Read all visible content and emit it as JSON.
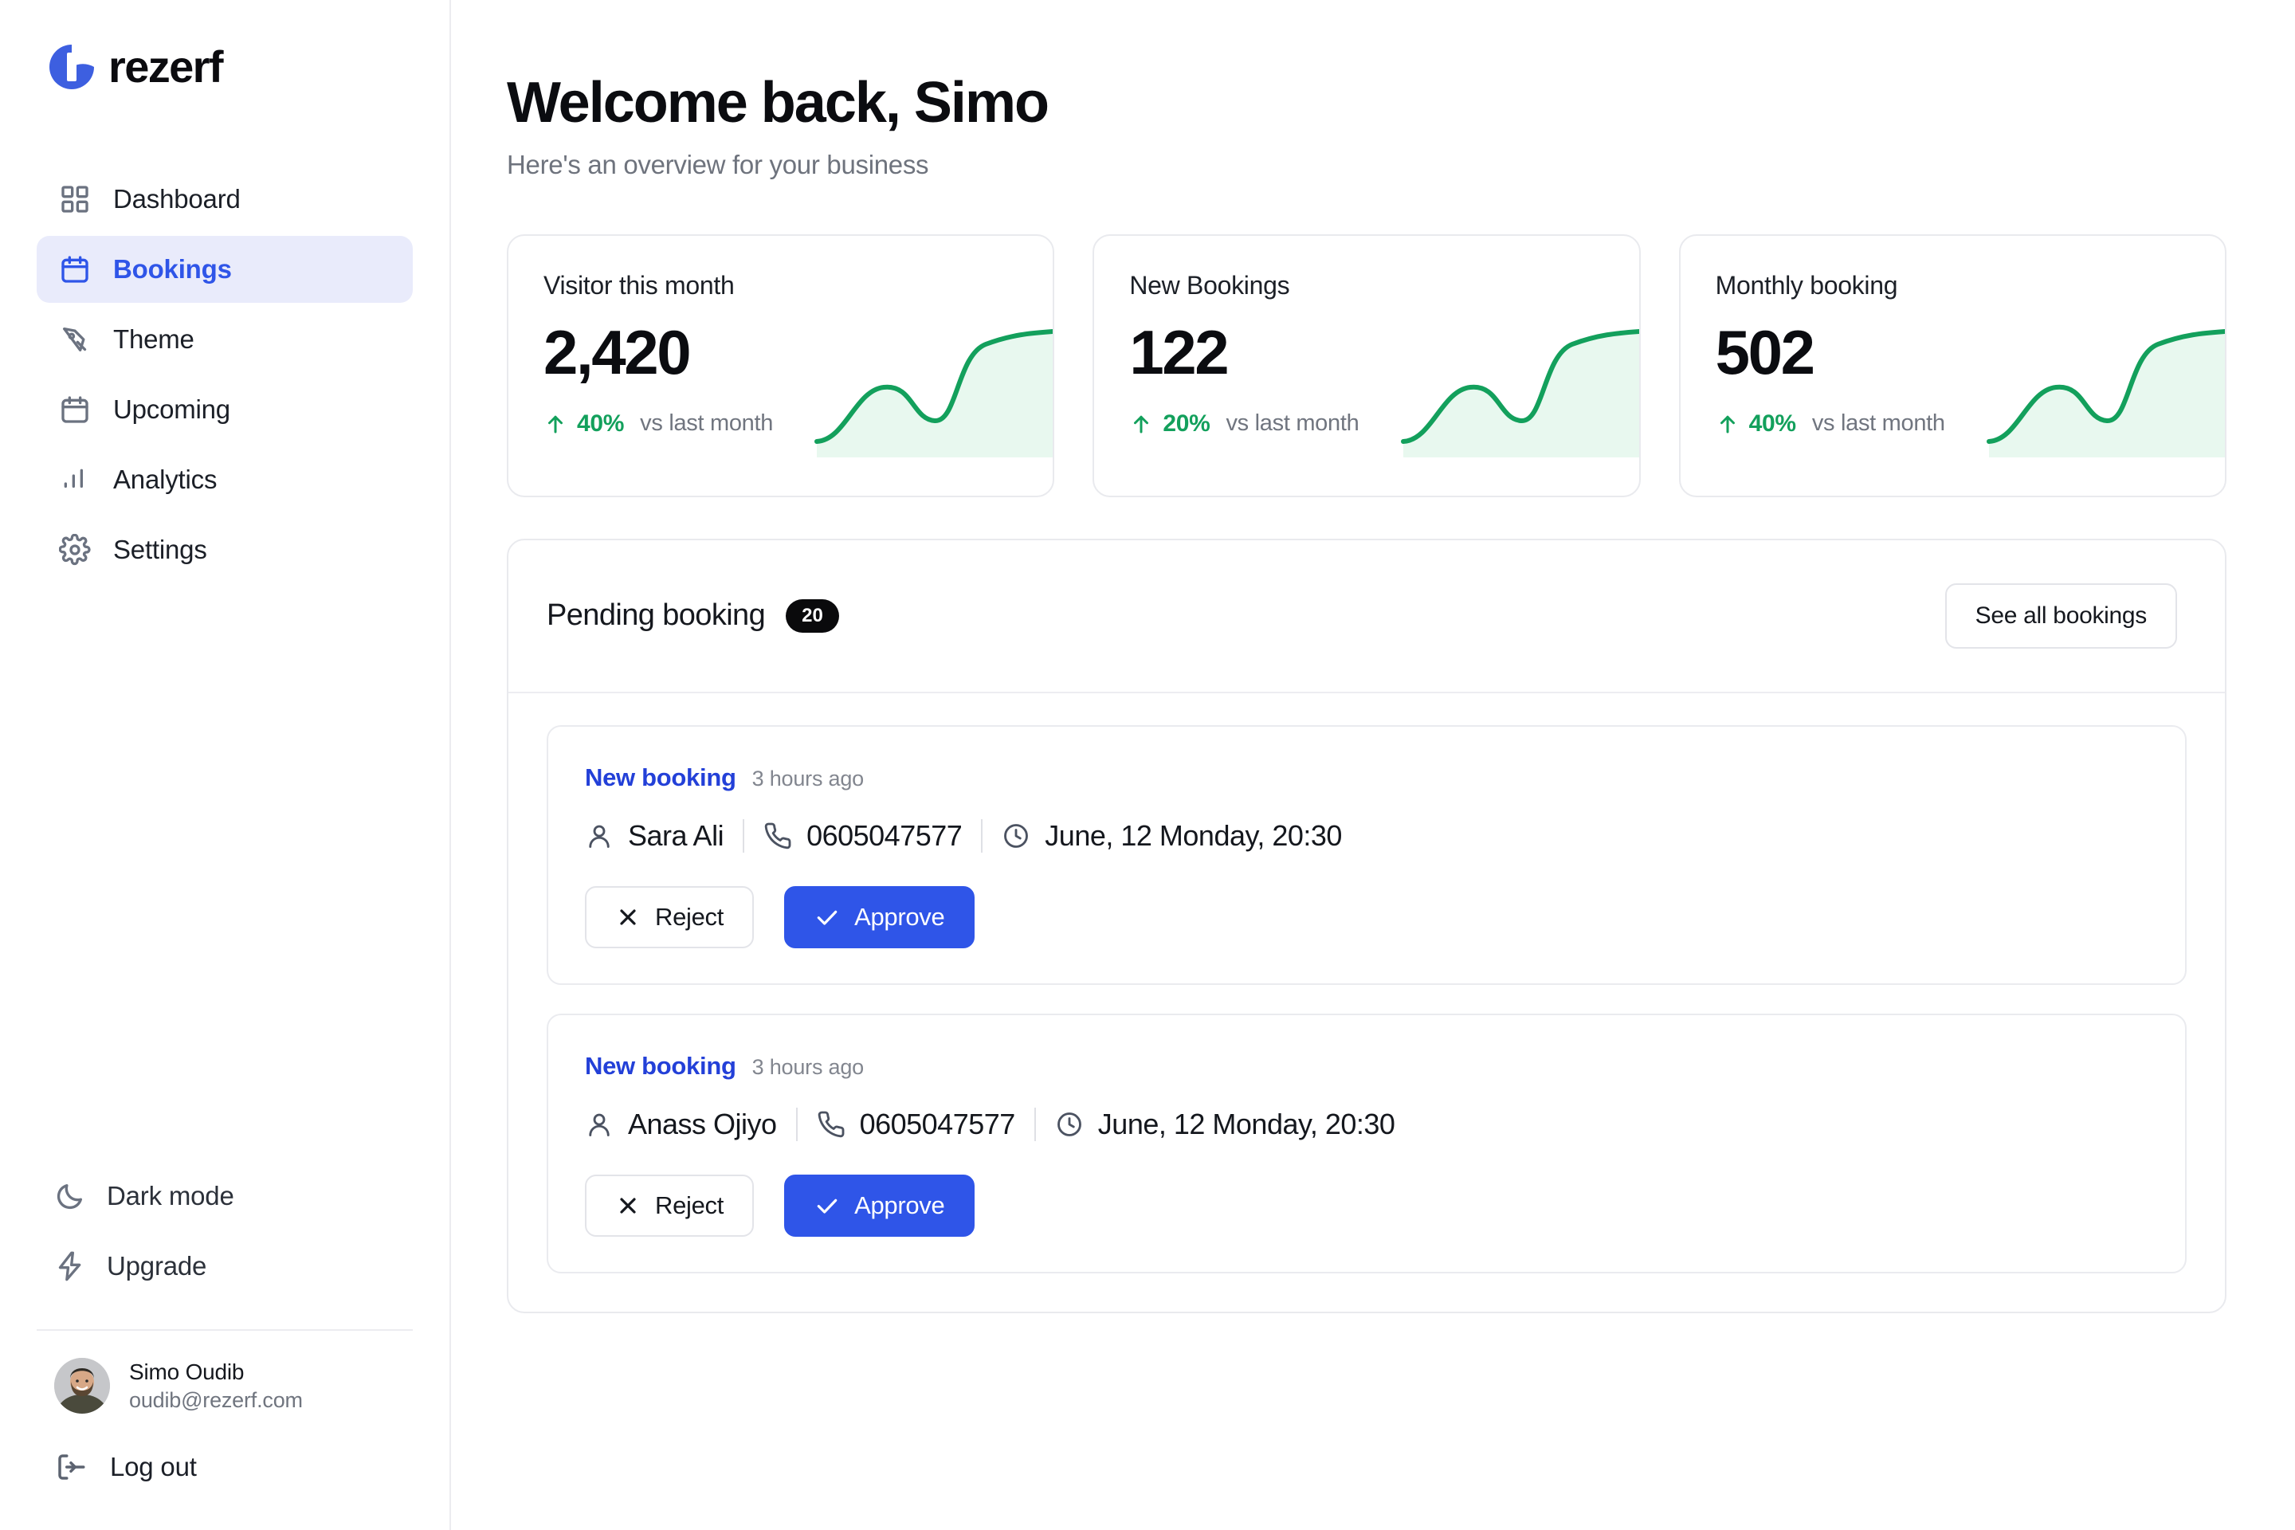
{
  "brand": {
    "name": "rezerf",
    "logo_icon": "rezerf-logo-mark",
    "color": "#3d5fe0"
  },
  "sidebar": {
    "nav": [
      {
        "label": "Dashboard",
        "icon": "grid-icon",
        "active": false
      },
      {
        "label": "Bookings",
        "icon": "calendar-icon",
        "active": true
      },
      {
        "label": "Theme",
        "icon": "pen-nib-icon",
        "active": false
      },
      {
        "label": "Upcoming",
        "icon": "calendar-icon",
        "active": false
      },
      {
        "label": "Analytics",
        "icon": "bar-chart-icon",
        "active": false
      },
      {
        "label": "Settings",
        "icon": "gear-icon",
        "active": false
      }
    ],
    "utility": [
      {
        "label": "Dark mode",
        "icon": "moon-icon"
      },
      {
        "label": "Upgrade",
        "icon": "lightning-bolt-icon"
      }
    ],
    "profile": {
      "name": "Simo Oudib",
      "email": "oudib@rezerf.com",
      "avatar_icon": "user-avatar-photo"
    },
    "logout": {
      "label": "Log out",
      "icon": "logout-icon"
    }
  },
  "header": {
    "title": "Welcome back, Simo",
    "subtitle": "Here's an overview for your business"
  },
  "stats": [
    {
      "title": "Visitor this month",
      "value": "2,420",
      "delta": "40%",
      "delta_note": "vs last month",
      "trend_icon": "arrow-up-icon",
      "accent": "#13a05c"
    },
    {
      "title": "New Bookings",
      "value": "122",
      "delta": "20%",
      "delta_note": "vs last month",
      "trend_icon": "arrow-up-icon",
      "accent": "#13a05c"
    },
    {
      "title": "Monthly booking",
      "value": "502",
      "delta": "40%",
      "delta_note": "vs last month",
      "trend_icon": "arrow-up-icon",
      "accent": "#13a05c"
    }
  ],
  "pending": {
    "title": "Pending booking",
    "count": "20",
    "see_all_label": "See all bookings",
    "bookings": [
      {
        "tag": "New booking",
        "time_ago": "3 hours ago",
        "name": "Sara Ali",
        "phone": "0605047577",
        "datetime": "June, 12 Monday, 20:30",
        "reject_label": "Reject",
        "approve_label": "Approve"
      },
      {
        "tag": "New booking",
        "time_ago": "3 hours ago",
        "name": "Anass Ojiyo",
        "phone": "0605047577",
        "datetime": "June, 12 Monday, 20:30",
        "reject_label": "Reject",
        "approve_label": "Approve"
      }
    ]
  },
  "chart_data": {
    "type": "line",
    "title": "",
    "series": [
      {
        "name": "Visitor this month",
        "values": [
          5,
          18,
          52,
          66,
          58,
          44,
          42,
          62,
          92,
          98
        ]
      },
      {
        "name": "New Bookings",
        "values": [
          5,
          18,
          52,
          66,
          58,
          44,
          42,
          62,
          92,
          98
        ]
      },
      {
        "name": "Monthly booking",
        "values": [
          5,
          18,
          52,
          66,
          58,
          44,
          42,
          62,
          92,
          98
        ]
      }
    ],
    "x": [
      0,
      1,
      2,
      3,
      4,
      5,
      6,
      7,
      8,
      9
    ],
    "xlabel": "",
    "ylabel": "",
    "grid": false,
    "legend": "none",
    "line_color": "#13a05c",
    "fill_color": "#e8f8ef"
  }
}
